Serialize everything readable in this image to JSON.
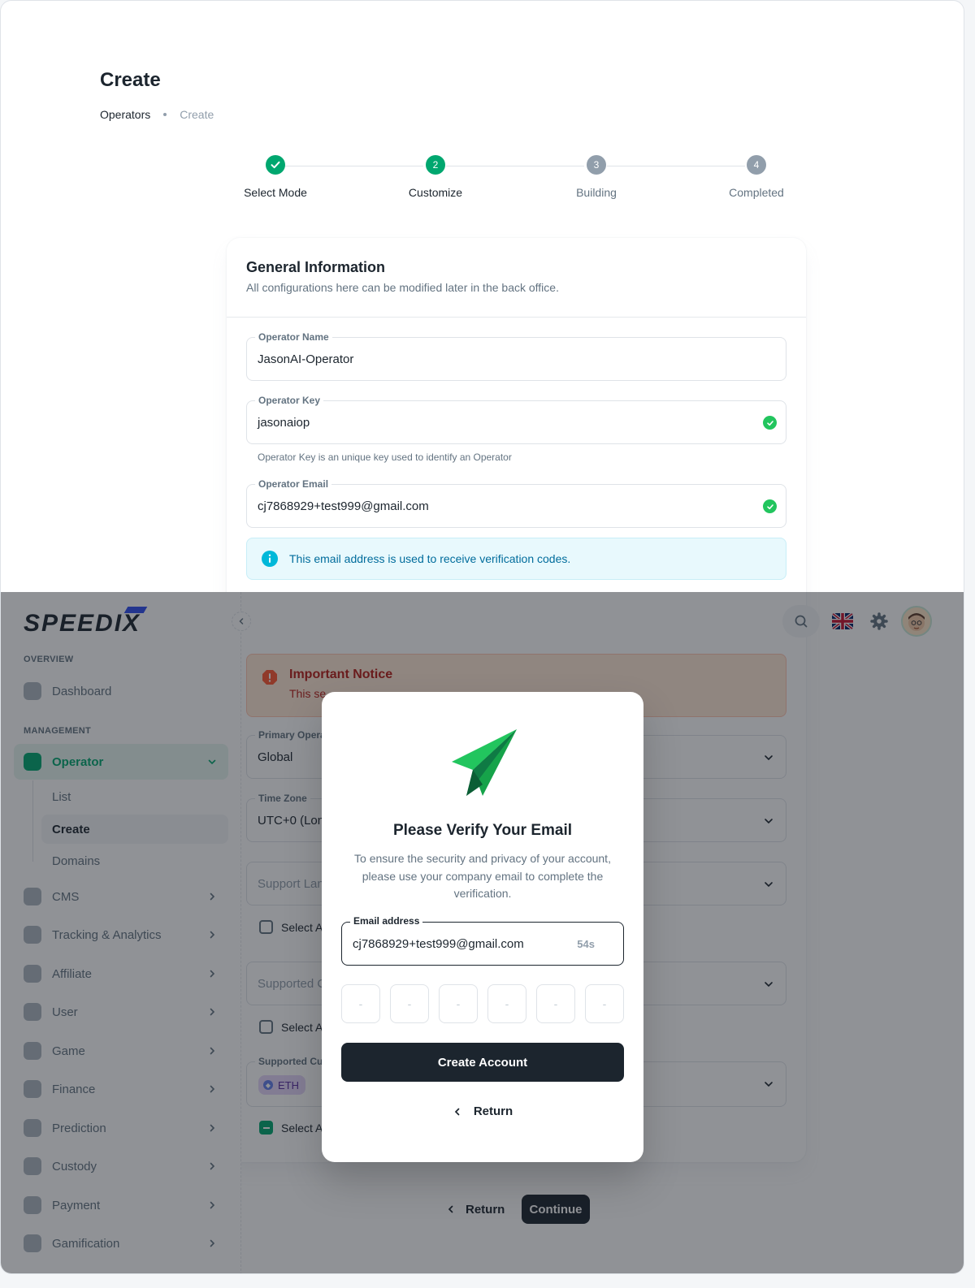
{
  "page": {
    "title": "Create"
  },
  "breadcrumb": {
    "parent": "Operators",
    "current": "Create"
  },
  "stepper": {
    "steps": [
      {
        "number": "",
        "label": "Select Mode",
        "state": "done"
      },
      {
        "number": "2",
        "label": "Customize",
        "state": "active"
      },
      {
        "number": "3",
        "label": "Building",
        "state": "pending"
      },
      {
        "number": "4",
        "label": "Completed",
        "state": "pending"
      }
    ]
  },
  "general": {
    "title": "General Information",
    "subtitle": "All configurations here can be modified later in the back office."
  },
  "form": {
    "operator_name": {
      "label": "Operator Name",
      "value": "JasonAI-Operator"
    },
    "operator_key": {
      "label": "Operator Key",
      "value": "jasonaiop",
      "helper": "Operator Key is an unique key used to identify an Operator"
    },
    "operator_email": {
      "label": "Operator Email",
      "value": "cj7868929+test999@gmail.com"
    },
    "info_alert": "This email address is used to receive verification codes.",
    "notice": {
      "title": "Important Notice",
      "text": "This se"
    },
    "primary_operation": {
      "label": "Primary Opera",
      "value": "Global"
    },
    "time_zone": {
      "label": "Time Zone",
      "value": "UTC+0 (Lon"
    },
    "support_language": {
      "placeholder": "Support Lan"
    },
    "select_all_1": "Select A",
    "supported_countries": {
      "placeholder": "Supported C"
    },
    "select_all_2": "Select A",
    "supported_currencies": {
      "label": "Supported Cu",
      "chip": "ETH"
    },
    "select_all_3": "Select A"
  },
  "actions": {
    "return": "Return",
    "continue": "Continue"
  },
  "sidebar": {
    "logo": "SPEEDIX",
    "overview_header": "OVERVIEW",
    "management_header": "MANAGEMENT",
    "items": {
      "dashboard": "Dashboard",
      "operator": "Operator",
      "list": "List",
      "create": "Create",
      "domains": "Domains",
      "cms": "CMS",
      "tracking": "Tracking & Analytics",
      "affiliate": "Affiliate",
      "user": "User",
      "game": "Game",
      "finance": "Finance",
      "prediction": "Prediction",
      "custody": "Custody",
      "payment": "Payment",
      "gamification": "Gamification"
    }
  },
  "modal": {
    "title": "Please Verify Your Email",
    "description": "To ensure the security and privacy of your account, please use your company email to complete the verification.",
    "email_label": "Email address",
    "email_value": "cj7868929+test999@gmail.com",
    "timer": "54s",
    "otp_placeholder": "-",
    "create_button": "Create Account",
    "return": "Return"
  },
  "colors": {
    "primary": "#00a76f",
    "dark": "#1c252e",
    "info": "#006c9c",
    "error": "#b71d18"
  }
}
